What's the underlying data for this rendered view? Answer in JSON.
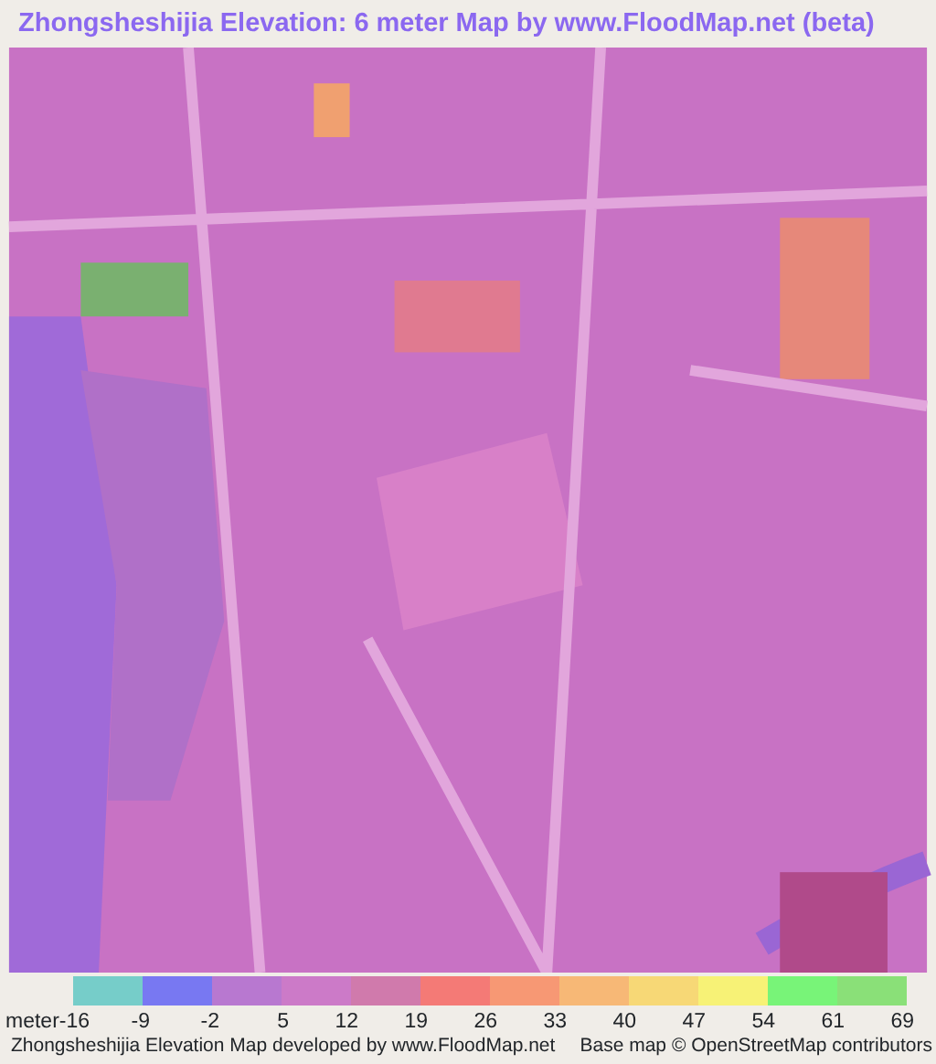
{
  "title": "Zhongsheshijia Elevation: 6 meter Map by www.FloodMap.net (beta)",
  "legend": {
    "unit": "meter",
    "swatches": [
      {
        "color": "#76cdc9"
      },
      {
        "color": "#7878f2"
      },
      {
        "color": "#b878d0"
      },
      {
        "color": "#cc7ac8"
      },
      {
        "color": "#d07aac"
      },
      {
        "color": "#f47a76"
      },
      {
        "color": "#f79874"
      },
      {
        "color": "#f7b876"
      },
      {
        "color": "#f7d876"
      },
      {
        "color": "#f7f276"
      },
      {
        "color": "#78f478"
      },
      {
        "color": "#8ae078"
      }
    ],
    "labels": [
      "-16",
      "-9",
      "-2",
      "5",
      "12",
      "19",
      "26",
      "33",
      "40",
      "47",
      "54",
      "61",
      "69"
    ]
  },
  "footer": {
    "credit": "Zhongsheshijia Elevation Map developed by www.FloodMap.net",
    "attribution": "Base map © OpenStreetMap contributors"
  }
}
